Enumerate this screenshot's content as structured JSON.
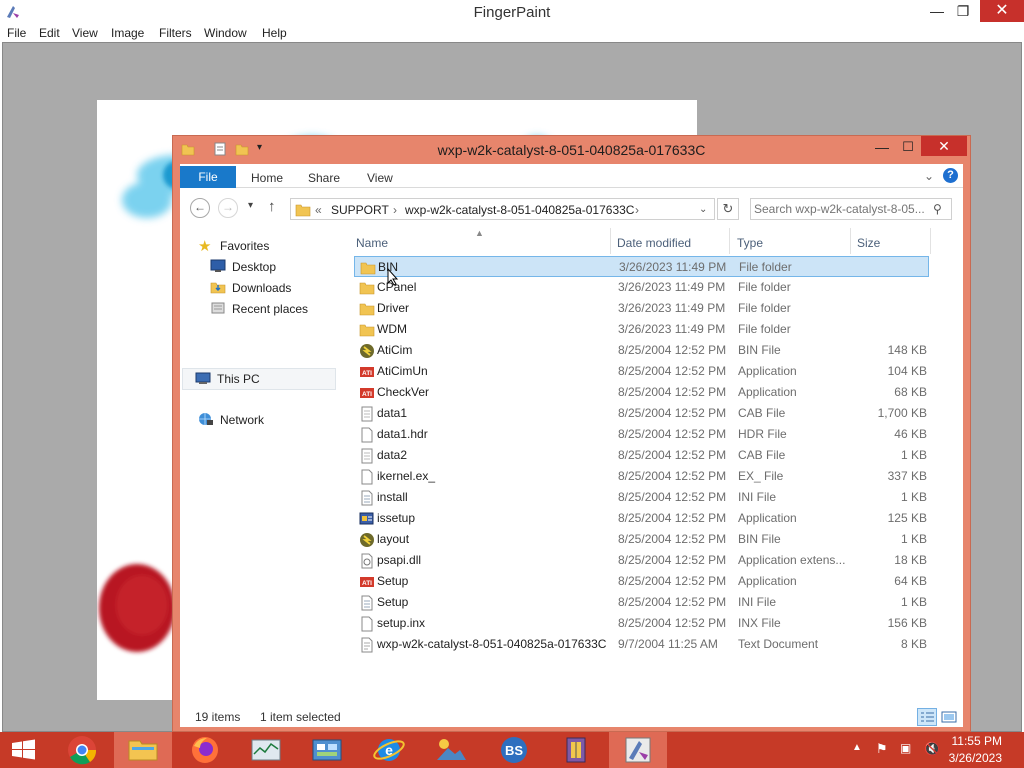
{
  "fingerpaint": {
    "title": "FingerPaint",
    "menu": [
      "File",
      "Edit",
      "View",
      "Image",
      "Filters",
      "Window",
      "Help"
    ],
    "controls": {
      "minimize": "—",
      "maximize": "❐",
      "close": "✕"
    }
  },
  "explorer": {
    "title": "wxp-w2k-catalyst-8-051-040825a-017633C",
    "controls": {
      "minimize": "—",
      "maximize": "☐",
      "close": "✕"
    },
    "ribbon": {
      "file": "File",
      "tabs": [
        "Home",
        "Share",
        "View"
      ],
      "help": "?"
    },
    "nav": {
      "back": "←",
      "forward": "→",
      "up": "↑",
      "refresh": "↻",
      "breadcrumb": [
        "«",
        "SUPPORT",
        "›",
        "wxp-w2k-catalyst-8-051-040825a-017633C",
        "›"
      ],
      "search_placeholder": "Search wxp-w2k-catalyst-8-05..."
    },
    "navpane": {
      "favorites": "Favorites",
      "desktop": "Desktop",
      "downloads": "Downloads",
      "recent": "Recent places",
      "thispc": "This PC",
      "network": "Network"
    },
    "columns": {
      "name": "Name",
      "date": "Date modified",
      "type": "Type",
      "size": "Size"
    },
    "files": [
      {
        "name": "BIN",
        "date": "3/26/2023 11:49 PM",
        "type": "File folder",
        "size": "",
        "icon": "folder"
      },
      {
        "name": "CPanel",
        "date": "3/26/2023 11:49 PM",
        "type": "File folder",
        "size": "",
        "icon": "folder"
      },
      {
        "name": "Driver",
        "date": "3/26/2023 11:49 PM",
        "type": "File folder",
        "size": "",
        "icon": "folder"
      },
      {
        "name": "WDM",
        "date": "3/26/2023 11:49 PM",
        "type": "File folder",
        "size": "",
        "icon": "folder"
      },
      {
        "name": "AtiCim",
        "date": "8/25/2004 12:52 PM",
        "type": "BIN File",
        "size": "148 KB",
        "icon": "bin"
      },
      {
        "name": "AtiCimUn",
        "date": "8/25/2004 12:52 PM",
        "type": "Application",
        "size": "104 KB",
        "icon": "ati"
      },
      {
        "name": "CheckVer",
        "date": "8/25/2004 12:52 PM",
        "type": "Application",
        "size": "68 KB",
        "icon": "ati"
      },
      {
        "name": "data1",
        "date": "8/25/2004 12:52 PM",
        "type": "CAB File",
        "size": "1,700 KB",
        "icon": "cab"
      },
      {
        "name": "data1.hdr",
        "date": "8/25/2004 12:52 PM",
        "type": "HDR File",
        "size": "46 KB",
        "icon": "doc"
      },
      {
        "name": "data2",
        "date": "8/25/2004 12:52 PM",
        "type": "CAB File",
        "size": "1 KB",
        "icon": "cab"
      },
      {
        "name": "ikernel.ex_",
        "date": "8/25/2004 12:52 PM",
        "type": "EX_ File",
        "size": "337 KB",
        "icon": "doc"
      },
      {
        "name": "install",
        "date": "8/25/2004 12:52 PM",
        "type": "INI File",
        "size": "1 KB",
        "icon": "ini"
      },
      {
        "name": "issetup",
        "date": "8/25/2004 12:52 PM",
        "type": "Application",
        "size": "125 KB",
        "icon": "app"
      },
      {
        "name": "layout",
        "date": "8/25/2004 12:52 PM",
        "type": "BIN File",
        "size": "1 KB",
        "icon": "bin"
      },
      {
        "name": "psapi.dll",
        "date": "8/25/2004 12:52 PM",
        "type": "Application extens...",
        "size": "18 KB",
        "icon": "dll"
      },
      {
        "name": "Setup",
        "date": "8/25/2004 12:52 PM",
        "type": "Application",
        "size": "64 KB",
        "icon": "ati"
      },
      {
        "name": "Setup",
        "date": "8/25/2004 12:52 PM",
        "type": "INI File",
        "size": "1 KB",
        "icon": "ini"
      },
      {
        "name": "setup.inx",
        "date": "8/25/2004 12:52 PM",
        "type": "INX File",
        "size": "156 KB",
        "icon": "doc"
      },
      {
        "name": "wxp-w2k-catalyst-8-051-040825a-017633C",
        "date": "9/7/2004 11:25 AM",
        "type": "Text Document",
        "size": "8 KB",
        "icon": "txt"
      }
    ],
    "selected_index": 0,
    "status": {
      "count": "19 items",
      "selection": "1 item selected"
    }
  },
  "taskbar": {
    "apps": [
      "start-button",
      "chrome",
      "file-explorer",
      "firefox",
      "task-manager",
      "control-panel",
      "internet-explorer",
      "photos",
      "bs-app",
      "archive",
      "fingerpaint"
    ],
    "active": "file-explorer",
    "time": "11:55 PM",
    "date": "3/26/2023"
  },
  "colors": {
    "explorer_frame": "#e7856c",
    "taskbar": "#c63a27",
    "accent_blue": "#1979ca",
    "selection": "#cce4f7"
  }
}
